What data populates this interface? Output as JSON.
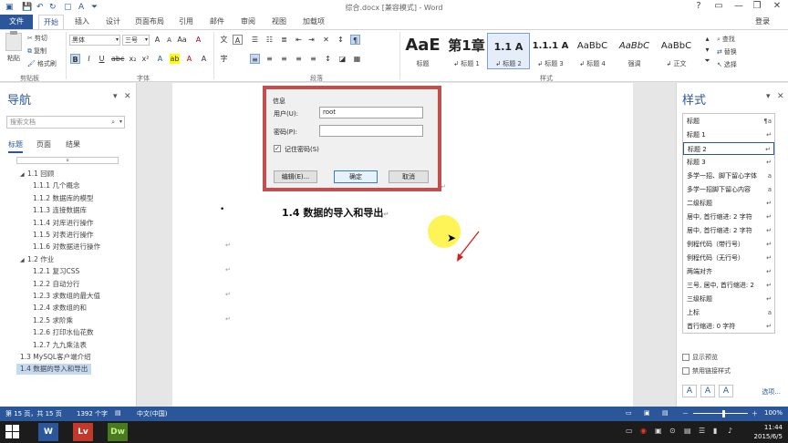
{
  "window": {
    "title": "综合.docx [兼容模式] - Word",
    "controls": [
      "?",
      "▭",
      "—",
      "❐",
      "✕"
    ]
  },
  "tabs": [
    "文件",
    "开始",
    "插入",
    "设计",
    "页面布局",
    "引用",
    "邮件",
    "审阅",
    "视图",
    "加载项"
  ],
  "login_label": "登录",
  "ribbon": {
    "clipboard": {
      "paste": "粘贴",
      "cut": "剪切",
      "copy": "复制",
      "format_painter": "格式刷",
      "group": "剪贴板"
    },
    "font": {
      "family": "黑体",
      "size": "三号",
      "group": "字体",
      "bold": "B",
      "italic": "I",
      "underline": "U"
    },
    "paragraph": {
      "group": "段落"
    },
    "styles": {
      "group": "样式",
      "tiles": [
        {
          "sample": "AaE",
          "label": "标题"
        },
        {
          "sample": "第1章",
          "label": "↲ 标题 1"
        },
        {
          "sample": "1.1 A",
          "label": "↲ 标题 2"
        },
        {
          "sample": "1.1.1 A",
          "label": "↲ 标题 3"
        },
        {
          "sample": "AaBbC",
          "label": "↲ 标题 4"
        },
        {
          "sample": "AaBbC",
          "label": "强调"
        },
        {
          "sample": "AaBbC",
          "label": "↲ 正文"
        }
      ]
    },
    "editing": {
      "find": "查找",
      "replace": "替换",
      "select": "选择"
    }
  },
  "nav": {
    "title": "导航",
    "search_placeholder": "搜索文档",
    "tabs": [
      "标题",
      "页面",
      "结果"
    ],
    "items": [
      {
        "label": "1.1 回顾",
        "level": 1,
        "twisty": "◢"
      },
      {
        "label": "1.1.1 几个概念",
        "level": 2
      },
      {
        "label": "1.1.2 数据库的模型",
        "level": 2
      },
      {
        "label": "1.1.3 连接数据库",
        "level": 2
      },
      {
        "label": "1.1.4 对库进行操作",
        "level": 2
      },
      {
        "label": "1.1.5 对表进行操作",
        "level": 2
      },
      {
        "label": "1.1.6 对数据进行操作",
        "level": 2
      },
      {
        "label": "1.2 作业",
        "level": 1,
        "twisty": "◢"
      },
      {
        "label": "1.2.1 复习CSS",
        "level": 2
      },
      {
        "label": "1.2.2 自动分行",
        "level": 2
      },
      {
        "label": "1.2.3 求数组的最大值",
        "level": 2
      },
      {
        "label": "1.2.4 求数组的和",
        "level": 2
      },
      {
        "label": "1.2.5 求阶乘",
        "level": 2
      },
      {
        "label": "1.2.6 打印水仙花数",
        "level": 2
      },
      {
        "label": "1.2.7 九九乘法表",
        "level": 2
      },
      {
        "label": "1.3 MySQL客户端介绍",
        "level": 1
      },
      {
        "label": "1.4 数据的导入和导出",
        "level": 1,
        "selected": true
      }
    ]
  },
  "dialog": {
    "group": "信息",
    "user_label": "用户(U):",
    "user_value": "root",
    "password_label": "密码(P):",
    "password_value": "",
    "remember_label": "记住密码(S)",
    "remember_checked": "✓",
    "buttons": {
      "edit": "编辑(E)...",
      "ok": "确定",
      "cancel": "取消"
    }
  },
  "document": {
    "heading": "1.4   数据的导入和导出",
    "bullet": "•",
    "para_mark": "↵"
  },
  "styles_pane": {
    "title": "样式",
    "items": [
      {
        "label": "标题",
        "mark": "¶a"
      },
      {
        "label": "标题 1",
        "mark": "↵"
      },
      {
        "label": "标题 2",
        "mark": "↵",
        "selected": true
      },
      {
        "label": "标题 3",
        "mark": "↵"
      },
      {
        "label": "多学一招、脚下留心字体",
        "mark": "a"
      },
      {
        "label": "多学一招脚下留心内容",
        "mark": "a"
      },
      {
        "label": "二级标题",
        "mark": "↵"
      },
      {
        "label": "居中, 首行缩进: 2 字符",
        "mark": "↵"
      },
      {
        "label": "居中, 首行缩进: 2 字符",
        "mark": "↵"
      },
      {
        "label": "例程代码（带行号）",
        "mark": "↵"
      },
      {
        "label": "例程代码（无行号）",
        "mark": "↵"
      },
      {
        "label": "两端对齐",
        "mark": "↵"
      },
      {
        "label": "三号, 居中, 首行缩进: 2",
        "mark": "↵"
      },
      {
        "label": "三级标题",
        "mark": "↵"
      },
      {
        "label": "上标",
        "mark": "a"
      },
      {
        "label": "首行缩进: 0 字符",
        "mark": "↵"
      }
    ],
    "show_preview": "显示预览",
    "disable_linked": "禁用链接样式",
    "options_link": "选项..."
  },
  "status": {
    "page": "第 15 页，共 15 页",
    "words": "1392 个字",
    "lang": "中文(中国)",
    "zoom": "100%",
    "minus": "－",
    "plus": "＋"
  },
  "taskbar": {
    "apps": [
      {
        "label": "W",
        "bg": "#2b579a",
        "fg": "#ffffff"
      },
      {
        "label": "Lv",
        "bg": "#c0392b",
        "fg": "#ffffff"
      },
      {
        "label": "Dw",
        "bg": "#4a7a1f",
        "fg": "#c6f08a"
      }
    ],
    "time": "11:44",
    "date": "2015/6/5"
  },
  "colors": {
    "accent": "#2b579a",
    "dialog_border": "#c0504d",
    "highlight": "#fff23a"
  }
}
